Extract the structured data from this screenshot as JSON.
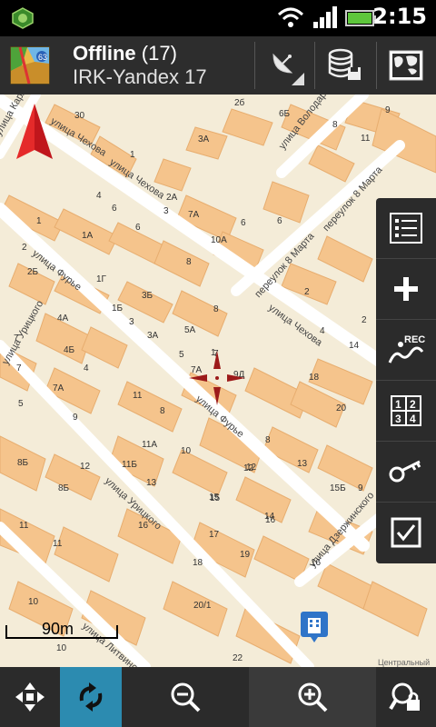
{
  "status_bar": {
    "time": "2:15",
    "icons": [
      "app-badge-icon",
      "wifi-icon",
      "signal-icon",
      "battery-icon"
    ]
  },
  "title_bar": {
    "title_bold": "Offline",
    "title_count": "(17)",
    "subtitle": "IRK-Yandex 17"
  },
  "toolbar_icons": [
    "satellite-icon",
    "database-icon",
    "map-layers-icon"
  ],
  "map": {
    "streets": [
      "улица Чехова",
      "улица Чехова",
      "улица Чехова",
      "улица Фурье",
      "улица Фурье",
      "улица Урицкого",
      "улица Урицкого",
      "улица Литвинова",
      "улица Володарского",
      "переулок 8 Марта",
      "переулок 8 Марта",
      "улица Дзержинского",
      "улица Карла Маркса"
    ],
    "house_numbers": [
      "30",
      "2б",
      "6Б",
      "8",
      "11",
      "3А",
      "1",
      "7А",
      "2А",
      "6",
      "4",
      "1А",
      "10А",
      "8",
      "3Б",
      "1Г",
      "1Б",
      "3",
      "3А",
      "5А",
      "7А",
      "4А",
      "4Б",
      "7",
      "7А",
      "9",
      "11",
      "8",
      "2",
      "14",
      "18",
      "20",
      "1",
      "9Д",
      "12",
      "13",
      "11А",
      "11Б",
      "10",
      "12",
      "13",
      "15",
      "16",
      "17",
      "19",
      "18",
      "20/1",
      "22",
      "16",
      "8Б",
      "10",
      "11",
      "14",
      "15Б",
      "9",
      "8",
      "7",
      "5",
      "2Б",
      "1",
      "6",
      "8Б",
      "12",
      "15",
      "16",
      "9",
      "11",
      "10",
      "6",
      "5",
      "2",
      "3",
      "7",
      "4",
      "8",
      "6",
      "4",
      "2"
    ],
    "scale_label": "90m",
    "copyright": "Центральный"
  },
  "side_panel": [
    "list-icon",
    "add-icon",
    "track-record-icon",
    "number-grid-icon",
    "key-icon",
    "checkbox-icon"
  ],
  "side_panel_labels": {
    "rec": "REC",
    "grid": [
      "1",
      "2",
      "3",
      "4"
    ]
  },
  "bottom_bar": [
    "move-arrows-icon",
    "sync-icon",
    "zoom-out-icon",
    "zoom-in-icon",
    "search-lock-icon"
  ]
}
